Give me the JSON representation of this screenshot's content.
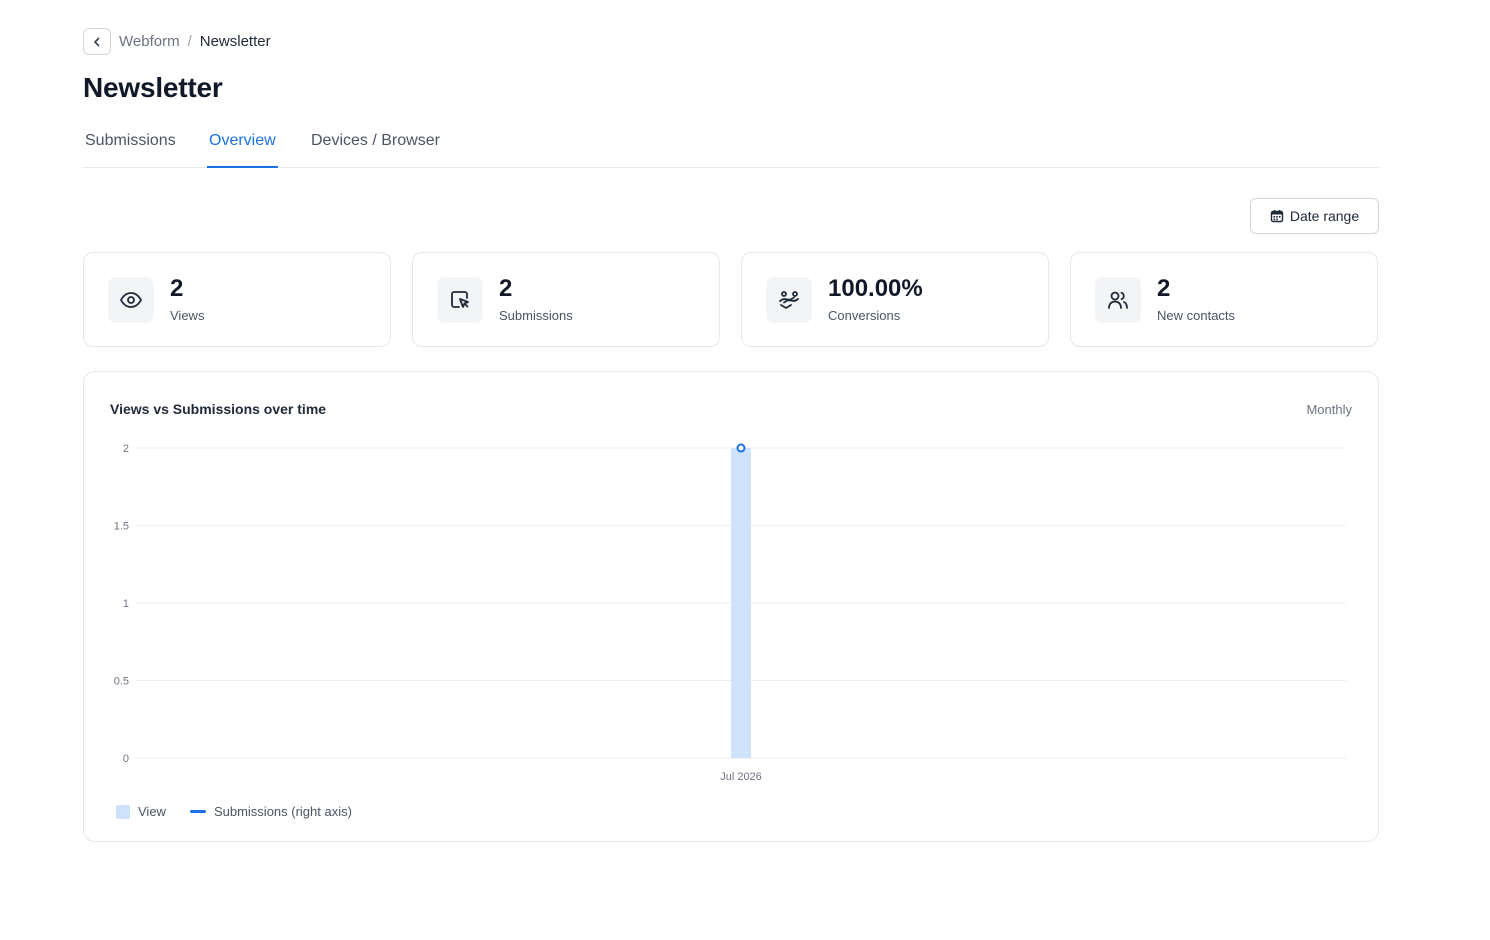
{
  "breadcrumb": {
    "parent": "Webform",
    "separator": "/",
    "current": "Newsletter"
  },
  "page_title": "Newsletter",
  "tabs": [
    {
      "label": "Submissions",
      "active": false
    },
    {
      "label": "Overview",
      "active": true
    },
    {
      "label": "Devices / Browser",
      "active": false
    }
  ],
  "date_range_label": "Date range",
  "stats": [
    {
      "icon": "eye-icon",
      "value": "2",
      "label": "Views"
    },
    {
      "icon": "cursor-click-icon",
      "value": "2",
      "label": "Submissions"
    },
    {
      "icon": "handshake-icon",
      "value": "100.00%",
      "label": "Conversions"
    },
    {
      "icon": "users-icon",
      "value": "2",
      "label": "New contacts"
    }
  ],
  "chart": {
    "title": "Views vs Submissions over time",
    "period": "Monthly",
    "legend": {
      "view": "View",
      "submissions": "Submissions (right axis)"
    }
  },
  "colors": {
    "accent": "#1d72e8",
    "bar": "#cfe2fb",
    "grid": "#eeeeee"
  },
  "chart_data": {
    "type": "bar",
    "categories": [
      "Jul 2026"
    ],
    "series": [
      {
        "name": "View",
        "type": "bar",
        "values": [
          2
        ]
      },
      {
        "name": "Submissions (right axis)",
        "type": "line",
        "values": [
          2
        ]
      }
    ],
    "yticks": [
      "0",
      "0.5",
      "1",
      "1.5",
      "2"
    ],
    "ylim": [
      0,
      2
    ],
    "grid": true,
    "legend_position": "bottom-left"
  }
}
